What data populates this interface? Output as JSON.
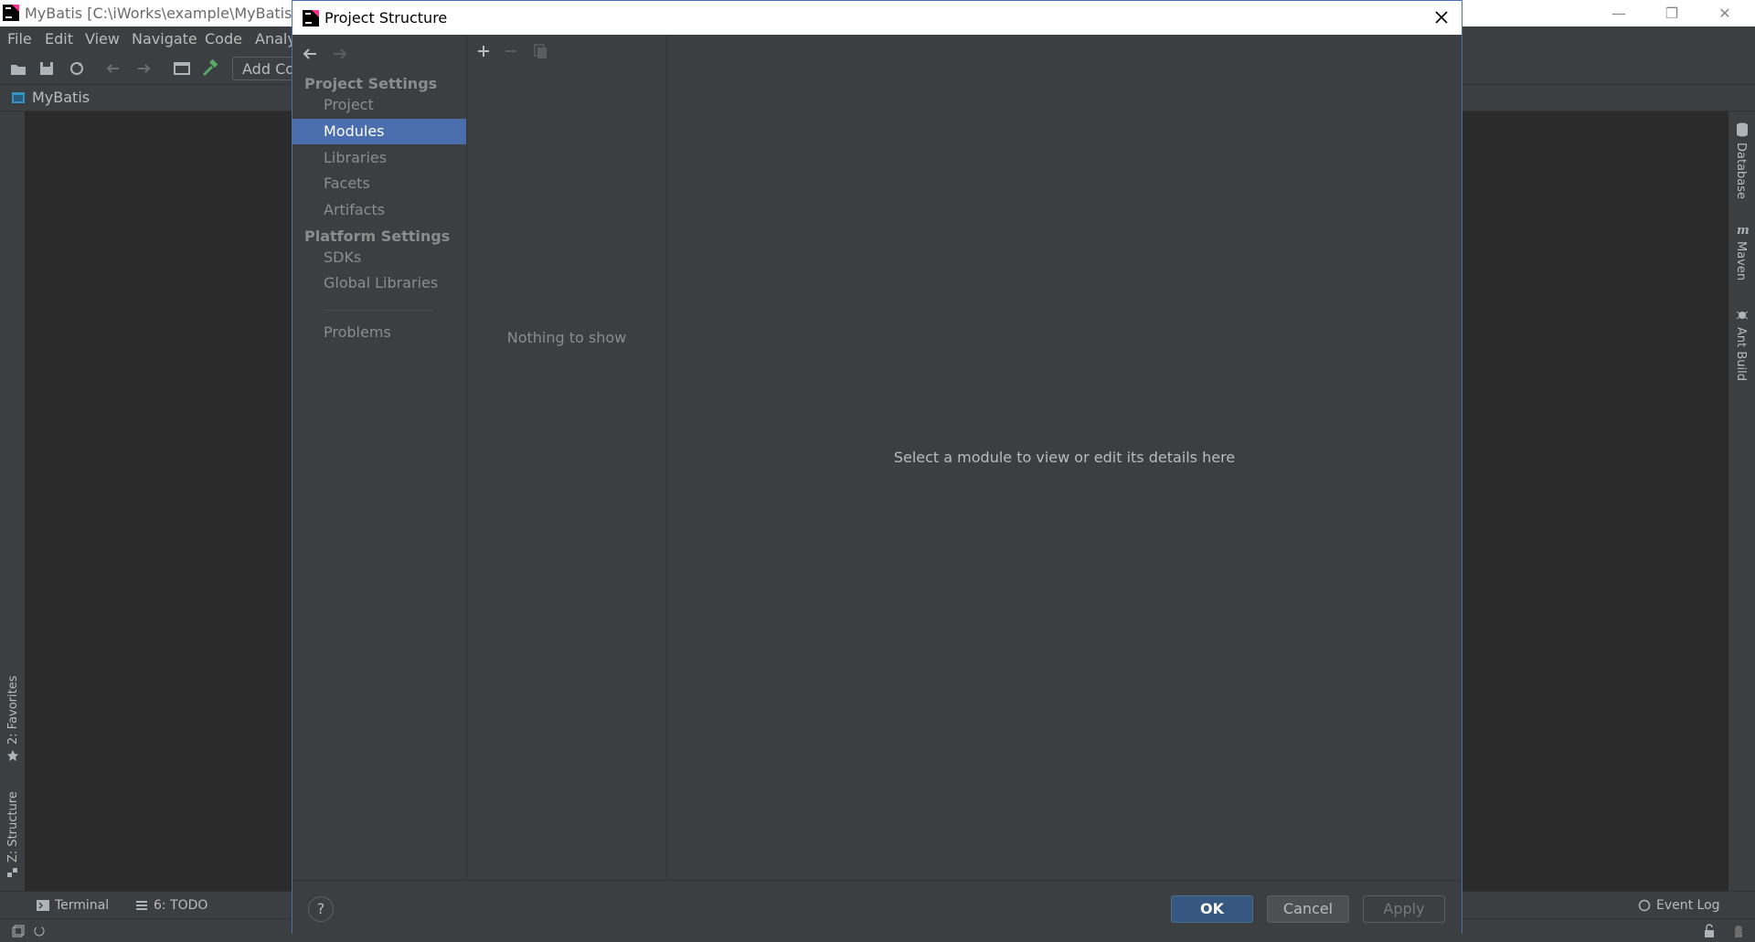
{
  "window": {
    "title": "MyBatis [C:\\iWorks\\example\\MyBatis] - I",
    "controls": [
      "minimize",
      "restore",
      "close"
    ]
  },
  "menu": [
    "File",
    "Edit",
    "View",
    "Navigate",
    "Code",
    "Analy"
  ],
  "toolbar": {
    "add_configuration_label": "Add Co"
  },
  "navbar": {
    "project_name": "MyBatis"
  },
  "right_tool_windows": [
    "Database",
    "Maven",
    "Ant Build"
  ],
  "left_tool_windows": [
    "2: Favorites",
    "Z: Structure"
  ],
  "bottom_tabs": [
    "Terminal",
    "6: TODO"
  ],
  "event_log_label": "Event Log",
  "dialog": {
    "title": "Project Structure",
    "project_settings_header": "Project Settings",
    "project_items": [
      "Project",
      "Modules",
      "Libraries",
      "Facets",
      "Artifacts"
    ],
    "selected_item": "Modules",
    "platform_settings_header": "Platform Settings",
    "platform_items": [
      "SDKs",
      "Global Libraries"
    ],
    "problems_label": "Problems",
    "empty_list_text": "Nothing to show",
    "detail_placeholder": "Select a module to view or edit its details here",
    "help_label": "?",
    "buttons": {
      "ok": "OK",
      "cancel": "Cancel",
      "apply": "Apply"
    }
  },
  "colors": {
    "accent": "#4b6eaf",
    "background": "#3c3f41",
    "ok_button": "#365880"
  }
}
